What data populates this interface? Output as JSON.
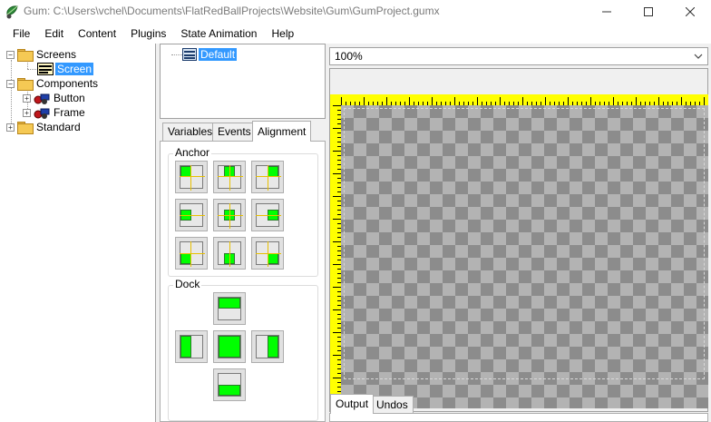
{
  "window": {
    "title": "Gum: C:\\Users\\vchel\\Documents\\FlatRedBallProjects\\Website\\Gum\\GumProject.gumx",
    "controls": {
      "minimize": "—",
      "maximize": "☐",
      "close": "✕"
    }
  },
  "menu": [
    "File",
    "Edit",
    "Content",
    "Plugins",
    "State Animation",
    "Help"
  ],
  "tree": {
    "screens": "Screens",
    "screen_item": "Screen",
    "components": "Components",
    "button": "Button",
    "frame": "Frame",
    "standard": "Standard",
    "expanded_glyph": "−",
    "collapsed_glyph": "+"
  },
  "states": {
    "default": "Default"
  },
  "tabs": [
    "Variables",
    "Events",
    "Alignment"
  ],
  "alignment": {
    "anchor_title": "Anchor",
    "dock_title": "Dock"
  },
  "editor": {
    "zoom": "100%",
    "zoom_arrow": "⌄"
  },
  "output_tabs": [
    "Output",
    "Undos"
  ],
  "colors": {
    "selection": "#3399ff",
    "ruler": "#ffff00",
    "anchor_fill": "#00ff00",
    "guide": "#e8c000"
  },
  "icons": {
    "app": "gum-app-icon",
    "folder": "folder-icon",
    "screen": "screen-icon",
    "component": "component-icon",
    "state": "state-icon"
  }
}
